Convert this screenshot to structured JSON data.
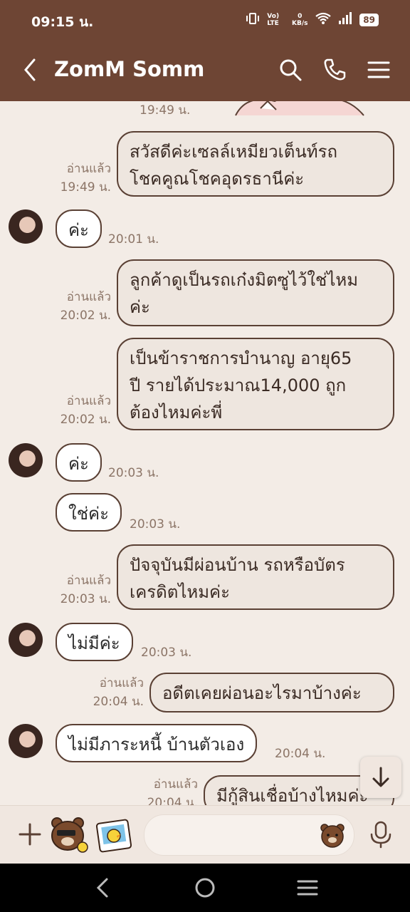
{
  "status": {
    "time": "09:15 น.",
    "volte": "Vo) LTE",
    "speed": "0 KB/s",
    "battery": "89"
  },
  "header": {
    "title": "ZomM Somm"
  },
  "messages": [
    {
      "id": "m0",
      "dir": "out",
      "time": "19:49 น."
    },
    {
      "id": "m1",
      "dir": "out",
      "read": "อ่านแล้ว",
      "time": "19:49 น.",
      "lines": [
        "สวัสดีค่ะเซลล์เหมียวเต็นท์รถ",
        "โชคคูณโชคอุดรธานีค่ะ"
      ]
    },
    {
      "id": "m2",
      "dir": "in",
      "time": "20:01 น.",
      "text": "ค่ะ"
    },
    {
      "id": "m3",
      "dir": "out",
      "read": "อ่านแล้ว",
      "time": "20:02 น.",
      "lines": [
        "ลูกค้าดูเป็นรถเก๋งมิตซูไว้ใช่ไหม",
        "ค่ะ"
      ]
    },
    {
      "id": "m4",
      "dir": "out",
      "read": "อ่านแล้ว",
      "time": "20:02 น.",
      "lines": [
        "เป็นข้าราชการบำนาญ อายุ65",
        "ปี รายได้ประมาณ14,000 ถูก",
        "ต้องไหมค่ะพี่"
      ]
    },
    {
      "id": "m5",
      "dir": "in",
      "time": "20:03 น.",
      "text": "ค่ะ"
    },
    {
      "id": "m6",
      "dir": "in",
      "time": "20:03 น.",
      "text": "ใช่ค่ะ"
    },
    {
      "id": "m7",
      "dir": "out",
      "read": "อ่านแล้ว",
      "time": "20:03 น.",
      "lines": [
        "ปัจจุบันมีผ่อนบ้าน รถหรือบัตร",
        "เครดิตไหมค่ะ"
      ]
    },
    {
      "id": "m8",
      "dir": "in",
      "time": "20:03 น.",
      "text": "ไม่มีค่ะ"
    },
    {
      "id": "m9",
      "dir": "out",
      "read": "อ่านแล้ว",
      "time": "20:04 น.",
      "lines": [
        "อดีตเคยผ่อนอะไรมาบ้างค่ะ"
      ]
    },
    {
      "id": "m10",
      "dir": "in",
      "time": "20:04 น.",
      "text": "ไม่มีภาระหนี้ บ้านตัวเอง"
    },
    {
      "id": "m11",
      "dir": "out",
      "read": "อ่านแล้ว",
      "time": "20:04 น.",
      "lines": [
        "มีกู้สินเชื่อบ้างไหมค่ะ"
      ]
    }
  ],
  "icons": {
    "back": "back-arrow-icon",
    "search": "search-icon",
    "call": "phone-icon",
    "menu": "hamburger-menu-icon",
    "add": "plus-icon",
    "sticker": "bear-sticker-icon",
    "gallery": "photo-gallery-icon",
    "emoji": "bear-face-icon",
    "mic": "microphone-icon",
    "scroll": "arrow-down-icon"
  },
  "colors": {
    "header": "#6e4534",
    "chat_bg": "#f3ece6",
    "bubble_out": "#eee6df",
    "bubble_in": "#ffffff",
    "border": "#5a4034",
    "meta": "#8c7567"
  }
}
